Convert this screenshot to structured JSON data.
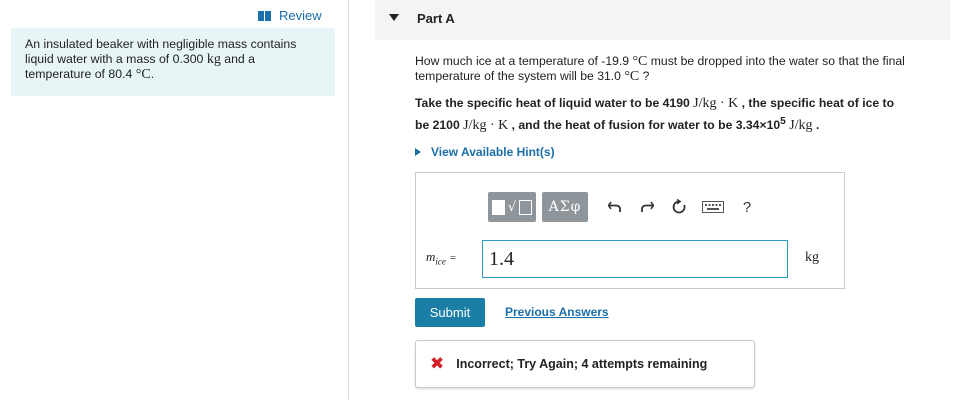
{
  "review": {
    "label": "Review",
    "icon": "book-icon"
  },
  "problem": {
    "line1": "An insulated beaker with negligible mass contains",
    "line2_a": "liquid water with a mass of 0.300 ",
    "line2_unit": "kg",
    "line2_b": " and a",
    "line3_a": "temperature of 80.4 ",
    "line3_unit": "°C",
    "line3_b": "."
  },
  "part": {
    "title": "Part A",
    "caret": "caret-down-icon"
  },
  "question": {
    "l1_a": "How much ice at a temperature of -19.9 ",
    "l1_unit": "°C",
    "l1_b": " must be dropped into the water so that the final",
    "l2_a": "temperature of the system will be 31.0 ",
    "l2_unit": "°C",
    "l2_b": " ?"
  },
  "instructions": {
    "l1_a": "Take the specific heat of liquid water to be 4190 ",
    "l1_unit": "J/kg · K",
    "l1_b": " , the specific heat of ice to",
    "l2_a": "be 2100 ",
    "l2_unit": "J/kg · K",
    "l2_b": " , and the heat of fusion for water to be 3.34×10",
    "l2_exp": "5",
    "l2_sp": " ",
    "l2_unit2": "J/kg",
    "l2_c": " ."
  },
  "hint": {
    "label": "View Available Hint(s)"
  },
  "toolbar": {
    "templates_root": "√",
    "symbols_label": "ΑΣφ",
    "undo": "undo-icon",
    "redo": "redo-icon",
    "reset": "reset-icon",
    "keyboard": "keyboard-icon",
    "help_label": "?"
  },
  "answer": {
    "var": "m",
    "sub": "ice",
    "eq": "=",
    "value": "1.4",
    "unit": "kg"
  },
  "actions": {
    "submit": "Submit",
    "previous": "Previous Answers"
  },
  "feedback": {
    "icon": "x-icon",
    "mark": "✖",
    "text": "Incorrect; Try Again; 4 attempts remaining"
  },
  "colors": {
    "accent": "#1b7ea6",
    "link": "#1a6fa8",
    "error": "#d32027",
    "problem_bg": "#e7f5f7"
  }
}
